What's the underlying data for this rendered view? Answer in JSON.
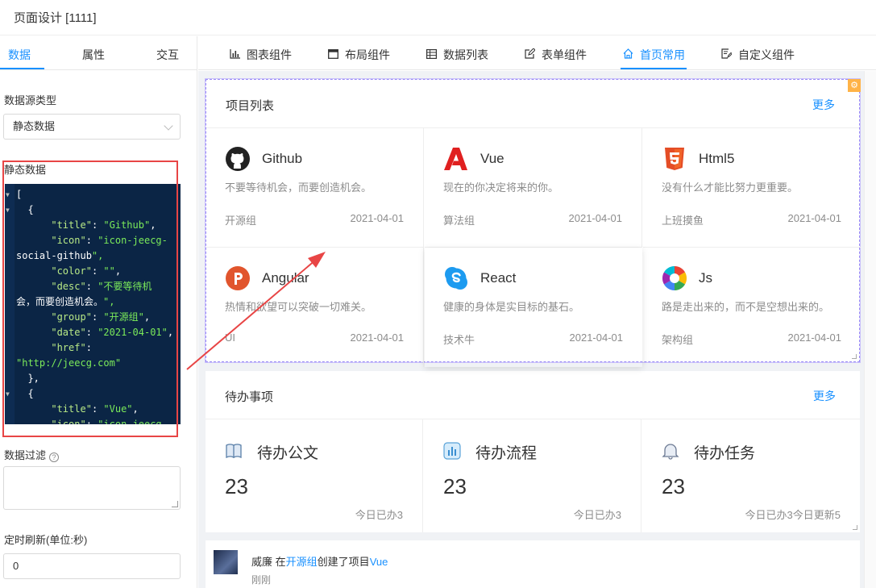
{
  "window": {
    "title": "页面设计 [1111]"
  },
  "left_tabs": [
    {
      "label": "数据",
      "active": true
    },
    {
      "label": "属性",
      "active": false
    },
    {
      "label": "交互",
      "active": false
    }
  ],
  "datasource": {
    "label": "数据源类型",
    "value": "静态数据"
  },
  "static_data": {
    "label": "静态数据",
    "lines": [
      "[",
      "  {",
      "      \"title\": \"Github\",",
      "      \"icon\": \"icon-jeecg-",
      "social-github\",",
      "      \"color\": \"\",",
      "      \"desc\": \"不要等待机",
      "会，而要创造机会。\",",
      "      \"group\": \"开源组\",",
      "      \"date\": \"2021-04-01\",",
      "      \"href\":",
      "\"http://jeecg.com\"",
      "  },",
      "  {",
      "      \"title\": \"Vue\",",
      "      \"icon\": \"icon-jeecg-"
    ]
  },
  "data_filter": {
    "label": "数据过滤",
    "value": ""
  },
  "refresh": {
    "label": "定时刷新(单位:秒)",
    "value": "0"
  },
  "top_tabs": [
    {
      "label": "图表组件",
      "icon": "bar-chart-icon",
      "active": false
    },
    {
      "label": "布局组件",
      "icon": "layout-icon",
      "active": false
    },
    {
      "label": "数据列表",
      "icon": "table-icon",
      "active": false
    },
    {
      "label": "表单组件",
      "icon": "form-edit-icon",
      "active": false
    },
    {
      "label": "首页常用",
      "icon": "home-icon",
      "active": true
    },
    {
      "label": "自定义组件",
      "icon": "custom-component-icon",
      "active": false
    }
  ],
  "projects": {
    "title": "项目列表",
    "more": "更多",
    "items": [
      {
        "name": "Github",
        "icon": "github-icon",
        "desc": "不要等待机会，而要创造机会。",
        "group": "开源组",
        "date": "2021-04-01"
      },
      {
        "name": "Vue",
        "icon": "vue-icon",
        "desc": "现在的你决定将来的你。",
        "group": "算法组",
        "date": "2021-04-01"
      },
      {
        "name": "Html5",
        "icon": "html5-icon",
        "desc": "没有什么才能比努力更重要。",
        "group": "上班摸鱼",
        "date": "2021-04-01"
      },
      {
        "name": "Angular",
        "icon": "angular-icon",
        "desc": "热情和欲望可以突破一切难关。",
        "group": "UI",
        "date": "2021-04-01"
      },
      {
        "name": "React",
        "icon": "react-icon",
        "desc": "健康的身体是实目标的基石。",
        "group": "技术牛",
        "date": "2021-04-01"
      },
      {
        "name": "Js",
        "icon": "js-icon",
        "desc": "路是走出来的，而不是空想出来的。",
        "group": "架构组",
        "date": "2021-04-01"
      }
    ]
  },
  "todo": {
    "title": "待办事项",
    "more": "更多",
    "items": [
      {
        "name": "待办公文",
        "icon": "book-icon",
        "count": "23",
        "sub": "今日已办3"
      },
      {
        "name": "待办流程",
        "icon": "flow-chart-icon",
        "count": "23",
        "sub": "今日已办3"
      },
      {
        "name": "待办任务",
        "icon": "bell-icon",
        "count": "23",
        "sub": "今日已办3今日更新5"
      }
    ]
  },
  "activity": {
    "user": "威廉",
    "in": "在",
    "group": "开源组",
    "action": "创建了项目",
    "project": "Vue",
    "time": "刚刚"
  },
  "colors": {
    "accent": "#1890ff",
    "code_bg": "#0b2545",
    "highlight_red": "#e84545"
  }
}
